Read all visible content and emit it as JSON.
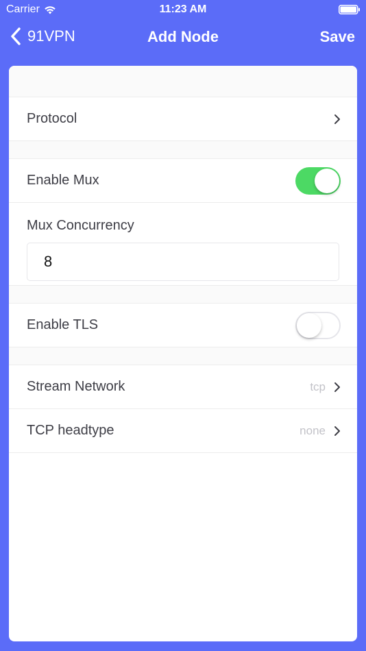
{
  "status_bar": {
    "carrier": "Carrier",
    "time": "11:23 AM"
  },
  "nav": {
    "back_label": "91VPN",
    "title": "Add Node",
    "save_label": "Save"
  },
  "rows": {
    "protocol": {
      "label": "Protocol"
    },
    "enable_mux": {
      "label": "Enable Mux",
      "enabled": true
    },
    "mux_concurrency": {
      "label": "Mux Concurrency",
      "value": "8"
    },
    "enable_tls": {
      "label": "Enable TLS",
      "enabled": false
    },
    "stream_network": {
      "label": "Stream Network",
      "value": "tcp"
    },
    "tcp_headtype": {
      "label": "TCP headtype",
      "value": "none"
    }
  },
  "colors": {
    "accent": "#5b6cf8",
    "toggle_on": "#4cd964",
    "card": "#ffffff"
  },
  "icons": {
    "wifi": "wifi-icon",
    "battery": "battery-icon",
    "back": "chevron-left-icon",
    "disclosure": "chevron-right-icon"
  }
}
